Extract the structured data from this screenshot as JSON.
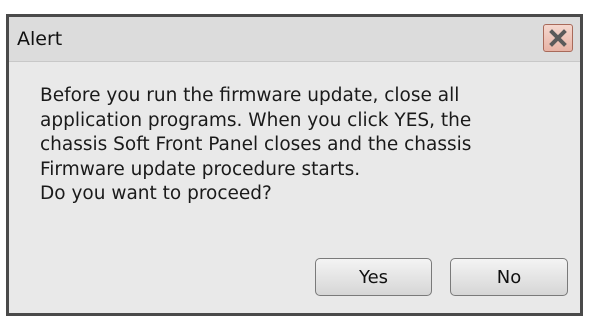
{
  "dialog": {
    "title": "Alert",
    "close_icon": "close-x-icon",
    "message": "Before you run the firmware update, close all\napplication programs. When you click YES, the\nchassis Soft Front Panel closes and the chassis\nFirmware update procedure starts.\nDo you want to proceed?",
    "yes_label": "Yes",
    "no_label": "No"
  },
  "colors": {
    "dialog_background": "#e9e9e9",
    "titlebar_background": "#dcdcdc",
    "border": "#4a4a4a",
    "close_button": "#e7b3a5",
    "close_glyph": "#5a5a5a"
  }
}
